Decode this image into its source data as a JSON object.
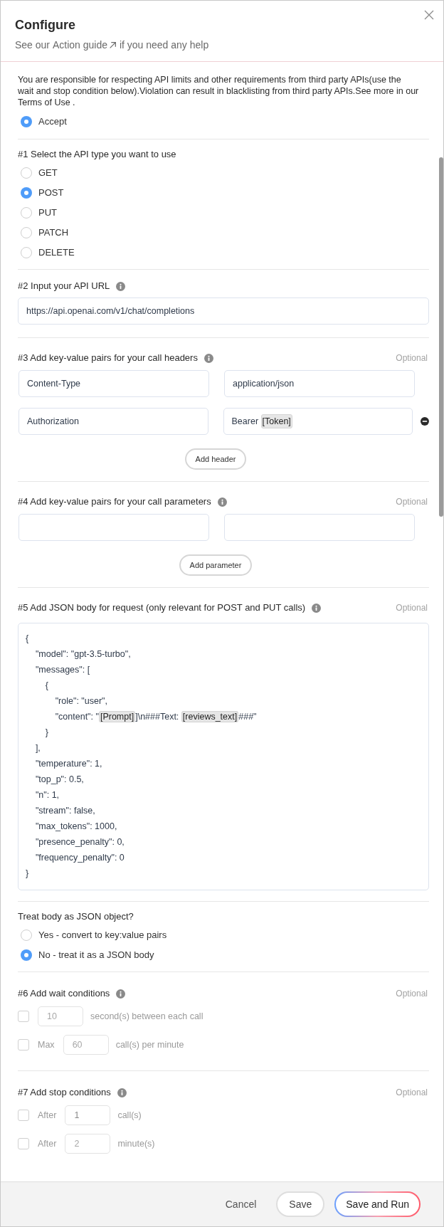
{
  "dialog": {
    "title": "Configure",
    "subtitle_before": "See our",
    "guide_link": "Action guide",
    "subtitle_after": "if you need any help"
  },
  "notice": {
    "text": "You are responsible for respecting API limits and other requirements from third party APIs(use the wait and stop condition below).Violation can result in blacklisting from third party APIs.See more in our Terms of Use .",
    "options": [
      {
        "label": "Accept",
        "selected": true
      }
    ]
  },
  "sections": [
    {
      "kind": "radio",
      "title": "#1 Select the API type you want to use",
      "options": [
        {
          "label": "GET",
          "selected": false
        },
        {
          "label": "POST",
          "selected": true
        },
        {
          "label": "PUT",
          "selected": false
        },
        {
          "label": "PATCH",
          "selected": false
        },
        {
          "label": "DELETE",
          "selected": false
        }
      ]
    },
    {
      "kind": "input",
      "title": "#2 Input your API URL",
      "info": true,
      "value": "https://api.openai.com/v1/chat/completions"
    },
    {
      "kind": "pairs",
      "title": "#3 Add key-value pairs for your call headers",
      "info": true,
      "optional": "Optional",
      "button": "Add header",
      "rows": [
        {
          "key": "Content-Type",
          "value": [
            {
              "kind": "plain",
              "text": "application/json"
            }
          ],
          "removable": false
        },
        {
          "key": "Authorization",
          "value": [
            {
              "kind": "plain",
              "text": "Bearer "
            },
            {
              "kind": "token",
              "text": "[Token]"
            }
          ],
          "removable": true
        }
      ]
    },
    {
      "kind": "pairs",
      "title": "#4 Add key-value pairs for your call parameters",
      "info": true,
      "optional": "Optional",
      "button": "Add parameter",
      "rows": [
        {
          "removable": false
        }
      ]
    },
    {
      "kind": "code",
      "title": "#5 Add JSON body for request (only relevant for POST and PUT calls)",
      "info": true,
      "optional": "Optional",
      "lines": [
        [
          {
            "kind": "plain",
            "text": "{"
          }
        ],
        [
          {
            "kind": "plain",
            "text": "    \"model\": \"gpt-3.5-turbo\","
          }
        ],
        [
          {
            "kind": "plain",
            "text": "    \"messages\": ["
          }
        ],
        [
          {
            "kind": "plain",
            "text": "        {"
          }
        ],
        [
          {
            "kind": "plain",
            "text": "            \"role\": \"user\","
          }
        ],
        [
          {
            "kind": "plain",
            "text": "            \"content\": \""
          },
          {
            "kind": "token",
            "text": "[Prompt]"
          },
          {
            "kind": "plain",
            "text": "]\\n###Text: "
          },
          {
            "kind": "token",
            "text": "[reviews_text]"
          },
          {
            "kind": "plain",
            "text": "###\""
          }
        ],
        [
          {
            "kind": "plain",
            "text": "        }"
          }
        ],
        [
          {
            "kind": "plain",
            "text": "    ],"
          }
        ],
        [
          {
            "kind": "plain",
            "text": "    \"temperature\": 1,"
          }
        ],
        [
          {
            "kind": "plain",
            "text": "    \"top_p\": 0.5,"
          }
        ],
        [
          {
            "kind": "plain",
            "text": "    \"n\": 1,"
          }
        ],
        [
          {
            "kind": "plain",
            "text": "    \"stream\": false,"
          }
        ],
        [
          {
            "kind": "plain",
            "text": "    \"max_tokens\": 1000,"
          }
        ],
        [
          {
            "kind": "plain",
            "text": "    \"presence_penalty\": 0,"
          }
        ],
        [
          {
            "kind": "plain",
            "text": "    \"frequency_penalty\": 0"
          }
        ],
        [
          {
            "kind": "plain",
            "text": "}"
          }
        ]
      ]
    },
    {
      "kind": "radio",
      "title": "Treat body as JSON object?",
      "options": [
        {
          "label": "Yes - convert to key:value pairs",
          "selected": false
        },
        {
          "label": "No - treat it as a JSON body",
          "selected": true
        }
      ]
    },
    {
      "kind": "conditions",
      "title": "#6 Add wait conditions",
      "info": true,
      "optional": "Optional",
      "rows": [
        {
          "checked": false,
          "placeholder": "10",
          "suffix": "second(s) between each call"
        },
        {
          "checked": false,
          "prefix": "Max",
          "placeholder": "60",
          "suffix": "call(s) per minute"
        }
      ]
    },
    {
      "kind": "conditions",
      "title": "#7 Add stop conditions",
      "info": true,
      "optional": "Optional",
      "rows": [
        {
          "checked": false,
          "prefix": "After",
          "value": "1",
          "suffix": "call(s)"
        },
        {
          "checked": false,
          "prefix": "After",
          "placeholder": "2",
          "suffix": "minute(s)"
        }
      ]
    }
  ],
  "footer": {
    "buttons": [
      {
        "kind": "text",
        "label": "Cancel"
      },
      {
        "kind": "outline",
        "label": "Save"
      },
      {
        "kind": "primary",
        "label": "Save and Run"
      }
    ]
  }
}
